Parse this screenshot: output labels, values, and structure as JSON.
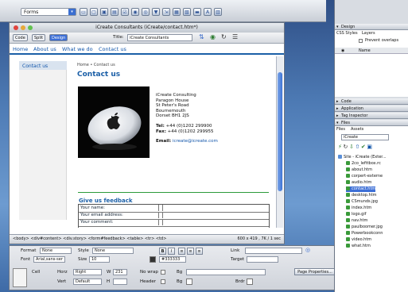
{
  "toolbar": {
    "category": "Forms",
    "icons": [
      "form-icon",
      "text-field-icon",
      "hidden-field-icon",
      "textarea-icon",
      "checkbox-icon",
      "radio-icon",
      "radio-group-icon",
      "list-menu-icon",
      "jump-menu-icon",
      "image-field-icon",
      "file-field-icon",
      "button-icon",
      "label-icon",
      "fieldset-icon"
    ]
  },
  "doc_window": {
    "title": "iCreate Consultants (iCreate/contact.htm*)",
    "views": [
      "Code",
      "Split",
      "Design"
    ],
    "title_label": "Title:",
    "title_value": "iCreate Consultants"
  },
  "site": {
    "nav": [
      "Home",
      "About us",
      "What we do",
      "Contact us"
    ],
    "side_nav": "Contact us",
    "breadcrumb": "Home • Contact us",
    "heading": "Contact us",
    "address": [
      "iCreate Consulting",
      "Paragon House",
      "St Peter's Road",
      "Bournemouth",
      "Dorset BH1 2JS"
    ],
    "tel_label": "Tel:",
    "tel": "+44 (0)1202 299900",
    "fax_label": "Fax:",
    "fax": "+44 (0)1202 299955",
    "email_label": "Email:",
    "email": "icreate@icreate.com",
    "form_title": "Give us feedback",
    "form_fields": [
      "Your name:",
      "Your email address:",
      "Your comment:"
    ]
  },
  "status": {
    "tags": "<body> <div#content> <div.story> <form#feedback> <table> <tr> <td>",
    "size": "600 x 419 , 7K / 1 sec"
  },
  "properties": {
    "format_label": "Format",
    "format": "None",
    "style_label": "Style",
    "style": "None",
    "font_label": "Font",
    "font": "Arial,sans-ser",
    "size_label": "Size",
    "size": "10",
    "color": "#333333",
    "link_label": "Link",
    "target_label": "Target",
    "cell_label": "Cell",
    "horz_label": "Horz",
    "horz": "Right",
    "w_label": "W",
    "w": "231",
    "nowrap_label": "No wrap",
    "bg_label": "Bg",
    "vert_label": "Vert",
    "vert": "Default",
    "h_label": "H",
    "header_label": "Header",
    "brdr_label": "Brdr",
    "page_props": "Page Properties..."
  },
  "panels": {
    "design": "Design",
    "design_tabs": [
      "CSS Styles",
      "Layers"
    ],
    "prevent_overlaps": "Prevent overlaps",
    "name_col": "Name",
    "code": "Code",
    "application": "Application",
    "tag_inspector": "Tag Inspector",
    "files": "Files",
    "files_tabs": [
      "Files",
      "Assets"
    ],
    "site_select": "iCreate",
    "files_list": [
      "Site - iCreate (Exter...",
      "2co_lefttbox.rc",
      "about.htm",
      "corpert-externe",
      "audio.htm",
      "contact.htm",
      "desktop.htm",
      "CSmunds.jpg",
      "index.htm",
      "logo.gif",
      "nav.htm",
      "paulboomer.jpg",
      "Powerbookconn",
      "video.htm",
      "what.htm"
    ]
  },
  "colors": {
    "link": "#1155aa",
    "heading": "#1b5fa7",
    "rule": "#2c9b3a",
    "selection": "#3d6fd6"
  }
}
